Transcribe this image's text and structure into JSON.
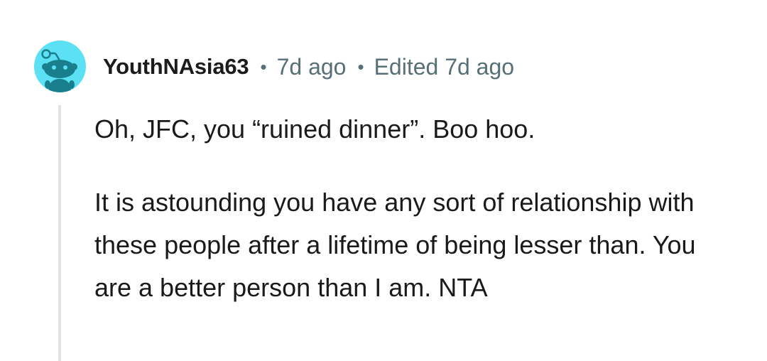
{
  "comment": {
    "author": "YouthNAsia63",
    "separator": "•",
    "age": "7d ago",
    "edited": "Edited 7d ago",
    "paragraphs": [
      "Oh, JFC, you “ruined dinner”. Boo hoo.",
      "It is astounding you have any sort of relationship with these people after a lifetime of being lesser than. You are a better person than I am. NTA"
    ],
    "avatar_icon": "reddit-snoo-icon",
    "colors": {
      "avatar_bg": "#5ce0f4",
      "meta_text": "#576f76",
      "thread_line": "#e0e3e5",
      "body_text": "#1a1a1b"
    }
  }
}
